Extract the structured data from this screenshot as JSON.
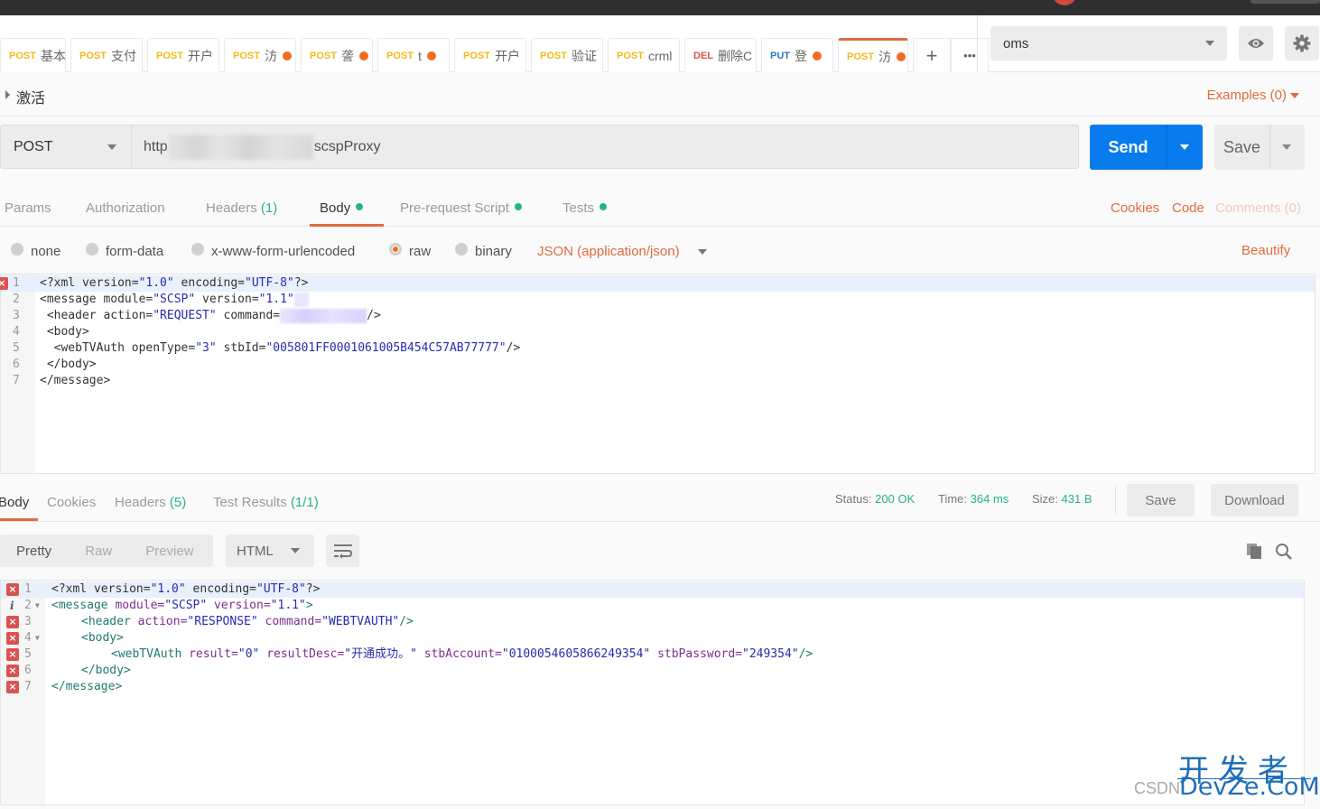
{
  "tabs": [
    {
      "method": "POST",
      "name": "基本",
      "dirty": false,
      "active": false
    },
    {
      "method": "POST",
      "name": "支付",
      "dirty": false,
      "active": false
    },
    {
      "method": "POST",
      "name": "开户",
      "dirty": false,
      "active": false
    },
    {
      "method": "POST",
      "name": "汸",
      "dirty": true,
      "active": false
    },
    {
      "method": "POST",
      "name": "詟",
      "dirty": true,
      "active": false
    },
    {
      "method": "POST",
      "name": "t",
      "dirty": true,
      "active": false
    },
    {
      "method": "POST",
      "name": "开户",
      "dirty": false,
      "active": false
    },
    {
      "method": "POST",
      "name": "验证",
      "dirty": false,
      "active": false
    },
    {
      "method": "POST",
      "name": "crml",
      "dirty": false,
      "active": false
    },
    {
      "method": "DEL",
      "name": "删除C",
      "dirty": false,
      "active": false
    },
    {
      "method": "PUT",
      "name": "登",
      "dirty": true,
      "active": false
    },
    {
      "method": "POST",
      "name": "汸",
      "dirty": true,
      "active": true
    }
  ],
  "tab_controls": {
    "new_tab": "+",
    "more": "•••"
  },
  "environment": {
    "selected": "oms"
  },
  "request": {
    "name": "激活",
    "examples_label": "Examples (0)",
    "method": "POST",
    "url_prefix": "http",
    "url_suffix": "scspProxy",
    "send_label": "Send",
    "save_label": "Save"
  },
  "request_tabs": {
    "params": "Params",
    "authorization": "Authorization",
    "headers": "Headers",
    "headers_count": "(1)",
    "body": "Body",
    "prerequest": "Pre-request Script",
    "tests": "Tests",
    "cookies": "Cookies",
    "code": "Code",
    "comments": "Comments (0)"
  },
  "body_types": {
    "none": "none",
    "form_data": "form-data",
    "urlencoded": "x-www-form-urlencoded",
    "raw": "raw",
    "binary": "binary",
    "selected": "raw",
    "content_type": "JSON (application/json)",
    "beautify": "Beautify"
  },
  "request_body": {
    "lines": [
      {
        "n": "1",
        "parts": [
          [
            "t-tag",
            "<?xml version="
          ],
          [
            "t-val",
            "\"1.0\""
          ],
          [
            "t-tag",
            " encoding="
          ],
          [
            "t-val",
            "\"UTF-8\""
          ],
          [
            "t-tag",
            "?>"
          ]
        ]
      },
      {
        "n": "2",
        "parts": [
          [
            "t-tag",
            "<message module="
          ],
          [
            "t-val",
            "\"SCSP\""
          ],
          [
            "t-tag",
            " version="
          ],
          [
            "t-val",
            "\"1.1\""
          ]
        ]
      },
      {
        "n": "3",
        "parts": [
          [
            "t-tag",
            " <header action="
          ],
          [
            "t-val",
            "\"REQUEST\""
          ],
          [
            "t-tag",
            " command="
          ]
        ],
        "redacted_then": "/>"
      },
      {
        "n": "4",
        "parts": [
          [
            "t-tag",
            " <body>"
          ]
        ]
      },
      {
        "n": "5",
        "parts": [
          [
            "t-tag",
            "  <webTVAuth openType="
          ],
          [
            "t-val",
            "\"3\""
          ],
          [
            "t-tag",
            " stbId="
          ],
          [
            "t-val",
            "\"005801FF0001061005B454C57AB77777\""
          ],
          [
            "t-tag",
            "/>"
          ]
        ]
      },
      {
        "n": "6",
        "parts": [
          [
            "t-tag",
            " </body>"
          ]
        ]
      },
      {
        "n": "7",
        "parts": [
          [
            "t-tag",
            "</message>"
          ]
        ]
      }
    ]
  },
  "response_tabs": {
    "body": "Body",
    "cookies": "Cookies",
    "headers": "Headers",
    "headers_count": "(5)",
    "test_results": "Test Results",
    "test_results_count": "(1/1)"
  },
  "response_meta": {
    "status_label": "Status:",
    "status_value": "200 OK",
    "time_label": "Time:",
    "time_value": "364 ms",
    "size_label": "Size:",
    "size_value": "431 B",
    "save_label": "Save",
    "download_label": "Download"
  },
  "response_view": {
    "pretty": "Pretty",
    "raw": "Raw",
    "preview": "Preview",
    "format": "HTML"
  },
  "response_body": {
    "lines": [
      {
        "n": "1",
        "mark": "error",
        "fold": false,
        "indent": 0,
        "parts": [
          [
            "t-tag",
            "<?xml version="
          ],
          [
            "rt-val",
            "\"1.0\""
          ],
          [
            "t-tag",
            " encoding="
          ],
          [
            "rt-val",
            "\"UTF-8\""
          ],
          [
            "t-tag",
            "?>"
          ]
        ]
      },
      {
        "n": "2",
        "mark": "info",
        "fold": true,
        "indent": 0,
        "parts": [
          [
            "rt-tag",
            "<message "
          ],
          [
            "rt-attr",
            "module="
          ],
          [
            "rt-val",
            "\"SCSP\""
          ],
          [
            "rt-attr",
            " version="
          ],
          [
            "rt-val",
            "\"1.1\""
          ],
          [
            "rt-tag",
            ">"
          ]
        ]
      },
      {
        "n": "3",
        "mark": "error",
        "fold": false,
        "indent": 1,
        "parts": [
          [
            "rt-tag",
            "<header "
          ],
          [
            "rt-attr",
            "action="
          ],
          [
            "rt-val",
            "\"RESPONSE\""
          ],
          [
            "rt-attr",
            " command="
          ],
          [
            "rt-val",
            "\"WEBTVAUTH\""
          ],
          [
            "rt-tag",
            "/>"
          ]
        ]
      },
      {
        "n": "4",
        "mark": "error",
        "fold": true,
        "indent": 1,
        "parts": [
          [
            "rt-tag",
            "<body>"
          ]
        ]
      },
      {
        "n": "5",
        "mark": "error",
        "fold": false,
        "indent": 2,
        "parts": [
          [
            "rt-tag",
            "<webTVAuth "
          ],
          [
            "rt-attr",
            "result="
          ],
          [
            "rt-val",
            "\"0\""
          ],
          [
            "rt-attr",
            " resultDesc="
          ],
          [
            "rt-val",
            "\"开通成功。\""
          ],
          [
            "rt-attr",
            " stbAccount="
          ],
          [
            "rt-val",
            "\"0100054605866249354\""
          ],
          [
            "rt-attr",
            " stbPassword="
          ],
          [
            "rt-val",
            "\"249354\""
          ],
          [
            "rt-tag",
            "/>"
          ]
        ]
      },
      {
        "n": "6",
        "mark": "error",
        "fold": false,
        "indent": 1,
        "parts": [
          [
            "rt-tag",
            "</body>"
          ]
        ]
      },
      {
        "n": "7",
        "mark": "error",
        "fold": false,
        "indent": 0,
        "parts": [
          [
            "rt-tag",
            "</message>"
          ]
        ]
      }
    ]
  },
  "watermark": {
    "cn": "开发者",
    "en": "DevZe.CoM",
    "csdn": "CSDN"
  }
}
